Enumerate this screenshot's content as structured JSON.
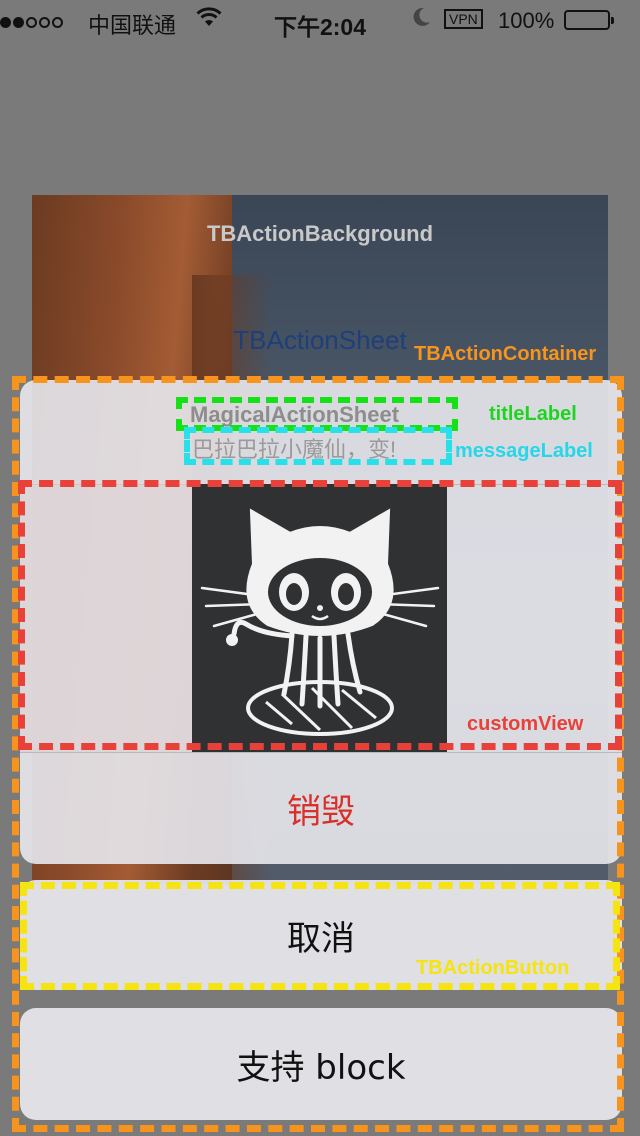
{
  "status_bar": {
    "carrier": "中国联通",
    "time": "下午2:04",
    "vpn": "VPN",
    "battery": "100%"
  },
  "background": {
    "label": "TBActionBackground",
    "sheet_label": "TBActionSheet"
  },
  "annotations": {
    "container": "TBActionContainer",
    "title": "titleLabel",
    "message": "messageLabel",
    "custom": "customView",
    "button": "TBActionButton"
  },
  "sheet": {
    "title": "MagicalActionSheet",
    "message": "巴拉巴拉小魔仙，变!",
    "destructive_button": "销毁",
    "cancel_button": "取消",
    "other_button": "支持 block"
  },
  "colors": {
    "destructive": "#d8312a",
    "container_outline": "#f7941d",
    "title_outline": "#16e016",
    "message_outline": "#27e0ea",
    "custom_outline": "#e8413a",
    "button_outline": "#f5e312",
    "battery": "#4cd964"
  },
  "icons": [
    "signal-dots-icon",
    "wifi-icon",
    "moon-icon",
    "battery-icon",
    "octocat-image"
  ]
}
